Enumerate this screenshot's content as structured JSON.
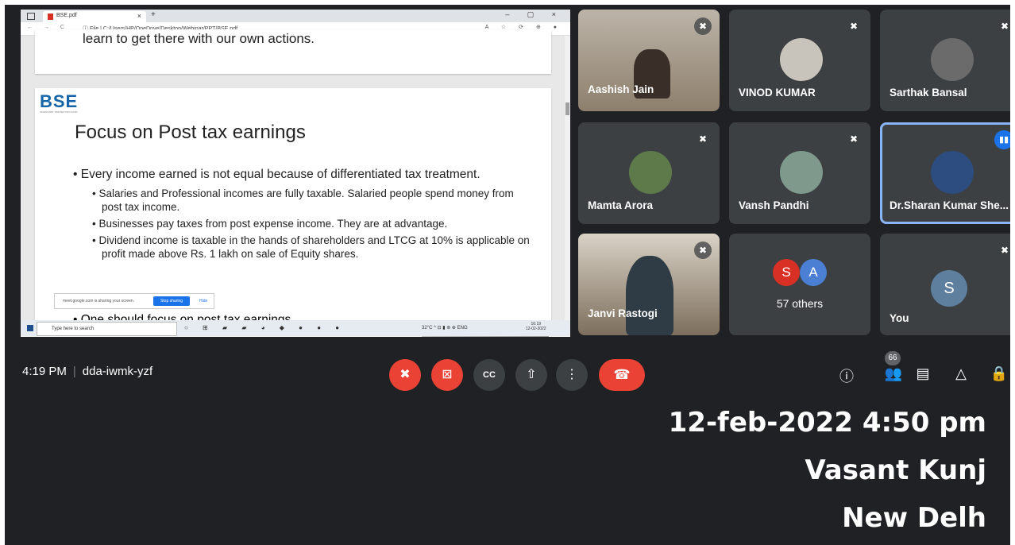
{
  "screen": {
    "browser": {
      "tab_title": "BSE.pdf",
      "tab_close": "×",
      "new_tab": "+",
      "window_controls": "– ▢ ×",
      "nav": "← → C",
      "url": "ⓘ File  |  C:/Users/HP/OneDrive/Desktop/Webinar/PPT/BSE.pdf",
      "tools": "A ☆ ⟳ ⊕ ●"
    },
    "page1_cutoff_text": "learn to get there with our own actions.",
    "slide": {
      "logo_text": "BSE",
      "logo_tagline": "INVESTORS' PROTECTION FUND",
      "title": "Focus on Post tax earnings",
      "bullets": [
        "• Every income earned is not equal because of differentiated tax treatment.",
        "• Salaries and Professional incomes are fully taxable. Salaried people spend money from post tax income.",
        "• Businesses pay taxes from post expense income. They are at advantage.",
        "• Dividend income is taxable in the hands of shareholders and LTCG at 10% is applicable on profit made above Rs. 1 lakh on sale of Equity shares.",
        "• One should focus on post tax earnings"
      ]
    },
    "share_banner": {
      "text": "meet.google.com is sharing your screen.",
      "stop": "Stop sharing",
      "hide": "Hide"
    },
    "taskbar": {
      "search_placeholder": "Type here to search",
      "tray_text": "32°C  ^ ⊡ ▮ ⊚ ⊕ ENG",
      "time": "16:19",
      "date": "12-02-2022"
    }
  },
  "participants": [
    {
      "name": "Aashish Jain",
      "muted": true
    },
    {
      "name": "VINOD KUMAR",
      "muted": true
    },
    {
      "name": "Sarthak Bansal",
      "muted": true
    },
    {
      "name": "Mamta Arora",
      "muted": true
    },
    {
      "name": "Vansh Pandhi",
      "muted": true
    },
    {
      "name": "Dr.Sharan Kumar She...",
      "speaking": true
    },
    {
      "name": "Janvi Rastogi",
      "muted": true
    },
    {
      "name": "57 others",
      "initials": [
        "S",
        "A"
      ]
    },
    {
      "name": "You",
      "initial": "S",
      "muted": true
    }
  ],
  "others_colors": {
    "S": "#d93025",
    "A": "#4a7fd4",
    "you": "#5f7f9e"
  },
  "icons": {
    "mic_off": "✖",
    "speaking": "▮▮"
  },
  "meeting": {
    "time": "4:19 PM",
    "separator": "|",
    "code": "dda-iwmk-yzf",
    "participant_count": "66"
  },
  "controls": {
    "mic": "✖",
    "camera": "⊠",
    "captions": "CC",
    "present": "⇧",
    "more": "⋮",
    "end": "☎"
  },
  "right_icons": {
    "info": "ⓘ",
    "people": "👥",
    "chat": "▤",
    "activities": "△",
    "safety": "🔒"
  },
  "overlay": {
    "datetime": "12-feb-2022 4:50 pm",
    "line2": "Vasant Kunj",
    "line3": "New Delh"
  }
}
